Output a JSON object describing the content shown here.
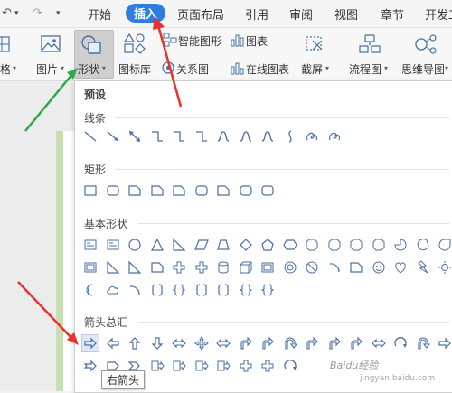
{
  "menubar": {
    "items": [
      {
        "label": "开始"
      },
      {
        "label": "插入",
        "active": true
      },
      {
        "label": "页面布局"
      },
      {
        "label": "引用"
      },
      {
        "label": "审阅"
      },
      {
        "label": "视图"
      },
      {
        "label": "章节"
      },
      {
        "label": "开发工"
      }
    ]
  },
  "toolbar": {
    "partial_left_label": "格",
    "picture_label": "图片",
    "shapes_label": "形状",
    "smartart_label": "智能图形",
    "chart_label": "图表",
    "iconlib_label": "图标库",
    "relation_label": "关系图",
    "onlinechart_label": "在线图表",
    "screenshot_label": "截屏",
    "flowchart_label": "流程图",
    "mindmap_label": "思维导图"
  },
  "panel": {
    "preset_title": "预设",
    "sections": [
      {
        "title": "线条",
        "count": 12
      },
      {
        "title": "矩形",
        "count": 9
      },
      {
        "title": "基本形状",
        "count": 32
      },
      {
        "title": "箭头总汇",
        "count": 27
      }
    ],
    "tooltip": "右箭头"
  },
  "watermark": {
    "text": "Baidu经验",
    "sub": "jingyan.baidu.com"
  },
  "colors": {
    "accent": "#2e7de1",
    "shape_stroke": "#4a6fa5",
    "annotation_red": "#e8322a",
    "annotation_green": "#2fa84f"
  }
}
